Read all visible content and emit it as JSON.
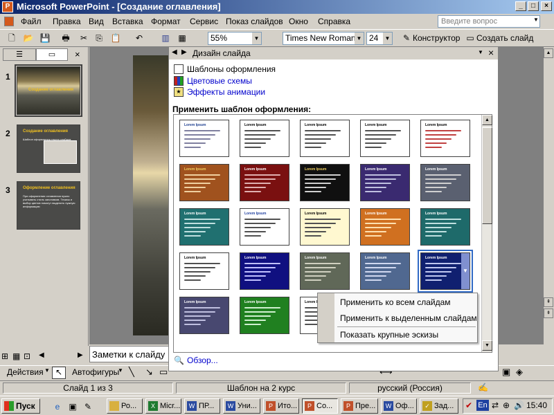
{
  "window": {
    "title": "Microsoft PowerPoint - [Создание оглавления]",
    "app_icon": "powerpoint-icon"
  },
  "menu": {
    "items": [
      "Файл",
      "Правка",
      "Вид",
      "Вставка",
      "Формат",
      "Сервис",
      "Показ слайдов",
      "Окно",
      "Справка"
    ],
    "ask_placeholder": "Введите вопрос"
  },
  "toolbar": {
    "zoom": "55%",
    "font": "Times New Roman",
    "font_size": "24",
    "designer": "Конструктор",
    "new_slide": "Создать слайд"
  },
  "slides": {
    "numbers": [
      "1",
      "2",
      "3"
    ],
    "thumbs": [
      {
        "title": "Создание оглавления",
        "body": ""
      },
      {
        "title": "Создание оглавления",
        "body": "Шаблон оформления текста слайдов"
      },
      {
        "title": "Оформление оглавления",
        "body": "При оформлении оглавления нужно учитывать стиль заголовков. Тезисы и выбор цветов помогут выделить нужную информацию"
      }
    ]
  },
  "notes": {
    "placeholder": "Заметки к слайду"
  },
  "task_pane": {
    "title": "Дизайн слайда",
    "links": [
      "Шаблоны оформления",
      "Цветовые схемы",
      "Эффекты анимации"
    ],
    "apply_label": "Применить шаблон оформления:",
    "browse": "Обзор...",
    "template_title": "Lorem Ipsum",
    "templates": [
      {
        "bg": "#ffffff",
        "title_color": "#1f3f8f",
        "line": "#7f7f9f"
      },
      {
        "bg": "#ffffff",
        "title_color": "#000000",
        "line": "#505050"
      },
      {
        "bg": "#ffffff",
        "title_color": "#000000",
        "line": "#505050"
      },
      {
        "bg": "#ffffff",
        "title_color": "#000000",
        "line": "#505050"
      },
      {
        "bg": "#ffffff",
        "title_color": "#000000",
        "line": "#c04040"
      },
      {
        "bg": "#a0521e",
        "title_color": "#f0d060",
        "line": "#f0d0a0"
      },
      {
        "bg": "#7a1010",
        "title_color": "#ffffff",
        "line": "#e0b0b0"
      },
      {
        "bg": "#101010",
        "title_color": "#f0d060",
        "line": "#d0d0d0"
      },
      {
        "bg": "#3a2a70",
        "title_color": "#ffffff",
        "line": "#c0c0e0"
      },
      {
        "bg": "#5a6070",
        "title_color": "#ffffff",
        "line": "#d0d0d0"
      },
      {
        "bg": "#207070",
        "title_color": "#ffffff",
        "line": "#c0e0e0"
      },
      {
        "bg": "#ffffff",
        "title_color": "#2040a0",
        "line": "#505050"
      },
      {
        "bg": "#fff8d0",
        "title_color": "#000000",
        "line": "#505050"
      },
      {
        "bg": "#d07020",
        "title_color": "#ffffff",
        "line": "#ffe0b0"
      },
      {
        "bg": "#1e6a6a",
        "title_color": "#ffffff",
        "line": "#c0e0e0"
      },
      {
        "bg": "#ffffff",
        "title_color": "#000000",
        "line": "#505050"
      },
      {
        "bg": "#101080",
        "title_color": "#ffffff",
        "line": "#c0c0ff"
      },
      {
        "bg": "#606858",
        "title_color": "#ffffff",
        "line": "#d0d0c0"
      },
      {
        "bg": "#506890",
        "title_color": "#ffffff",
        "line": "#d0d8f0"
      },
      {
        "bg": "#102070",
        "title_color": "#ffffff",
        "line": "#c0c8f0"
      },
      {
        "bg": "#484870",
        "title_color": "#ffffff",
        "line": "#c0c0e0"
      },
      {
        "bg": "#208020",
        "title_color": "#ffffff",
        "line": "#d0f0d0"
      },
      {
        "bg": "#ffffff",
        "title_color": "#000000",
        "line": "#505050"
      }
    ]
  },
  "context_menu": {
    "items": [
      "Применить ко всем слайдам",
      "Применить к выделенным слайдам",
      "Показать крупные эскизы"
    ]
  },
  "draw_toolbar": {
    "actions": "Действия",
    "autoshapes": "Автофигуры"
  },
  "status": {
    "slide": "Слайд 1 из 3",
    "template": "Шаблон на 2 курс",
    "language": "русский (Россия)"
  },
  "taskbar": {
    "start": "Пуск",
    "buttons": [
      "Ро...",
      "Micr...",
      "ПР...",
      "Уни...",
      "Ито...",
      "Со...",
      "Пре...",
      "Оф...",
      "Зад..."
    ],
    "lang": "En",
    "clock": "15:40"
  },
  "colors": {
    "title_gradient_start": "#0a246a",
    "link_blue": "#0000cc",
    "selection": "#316ac5"
  }
}
